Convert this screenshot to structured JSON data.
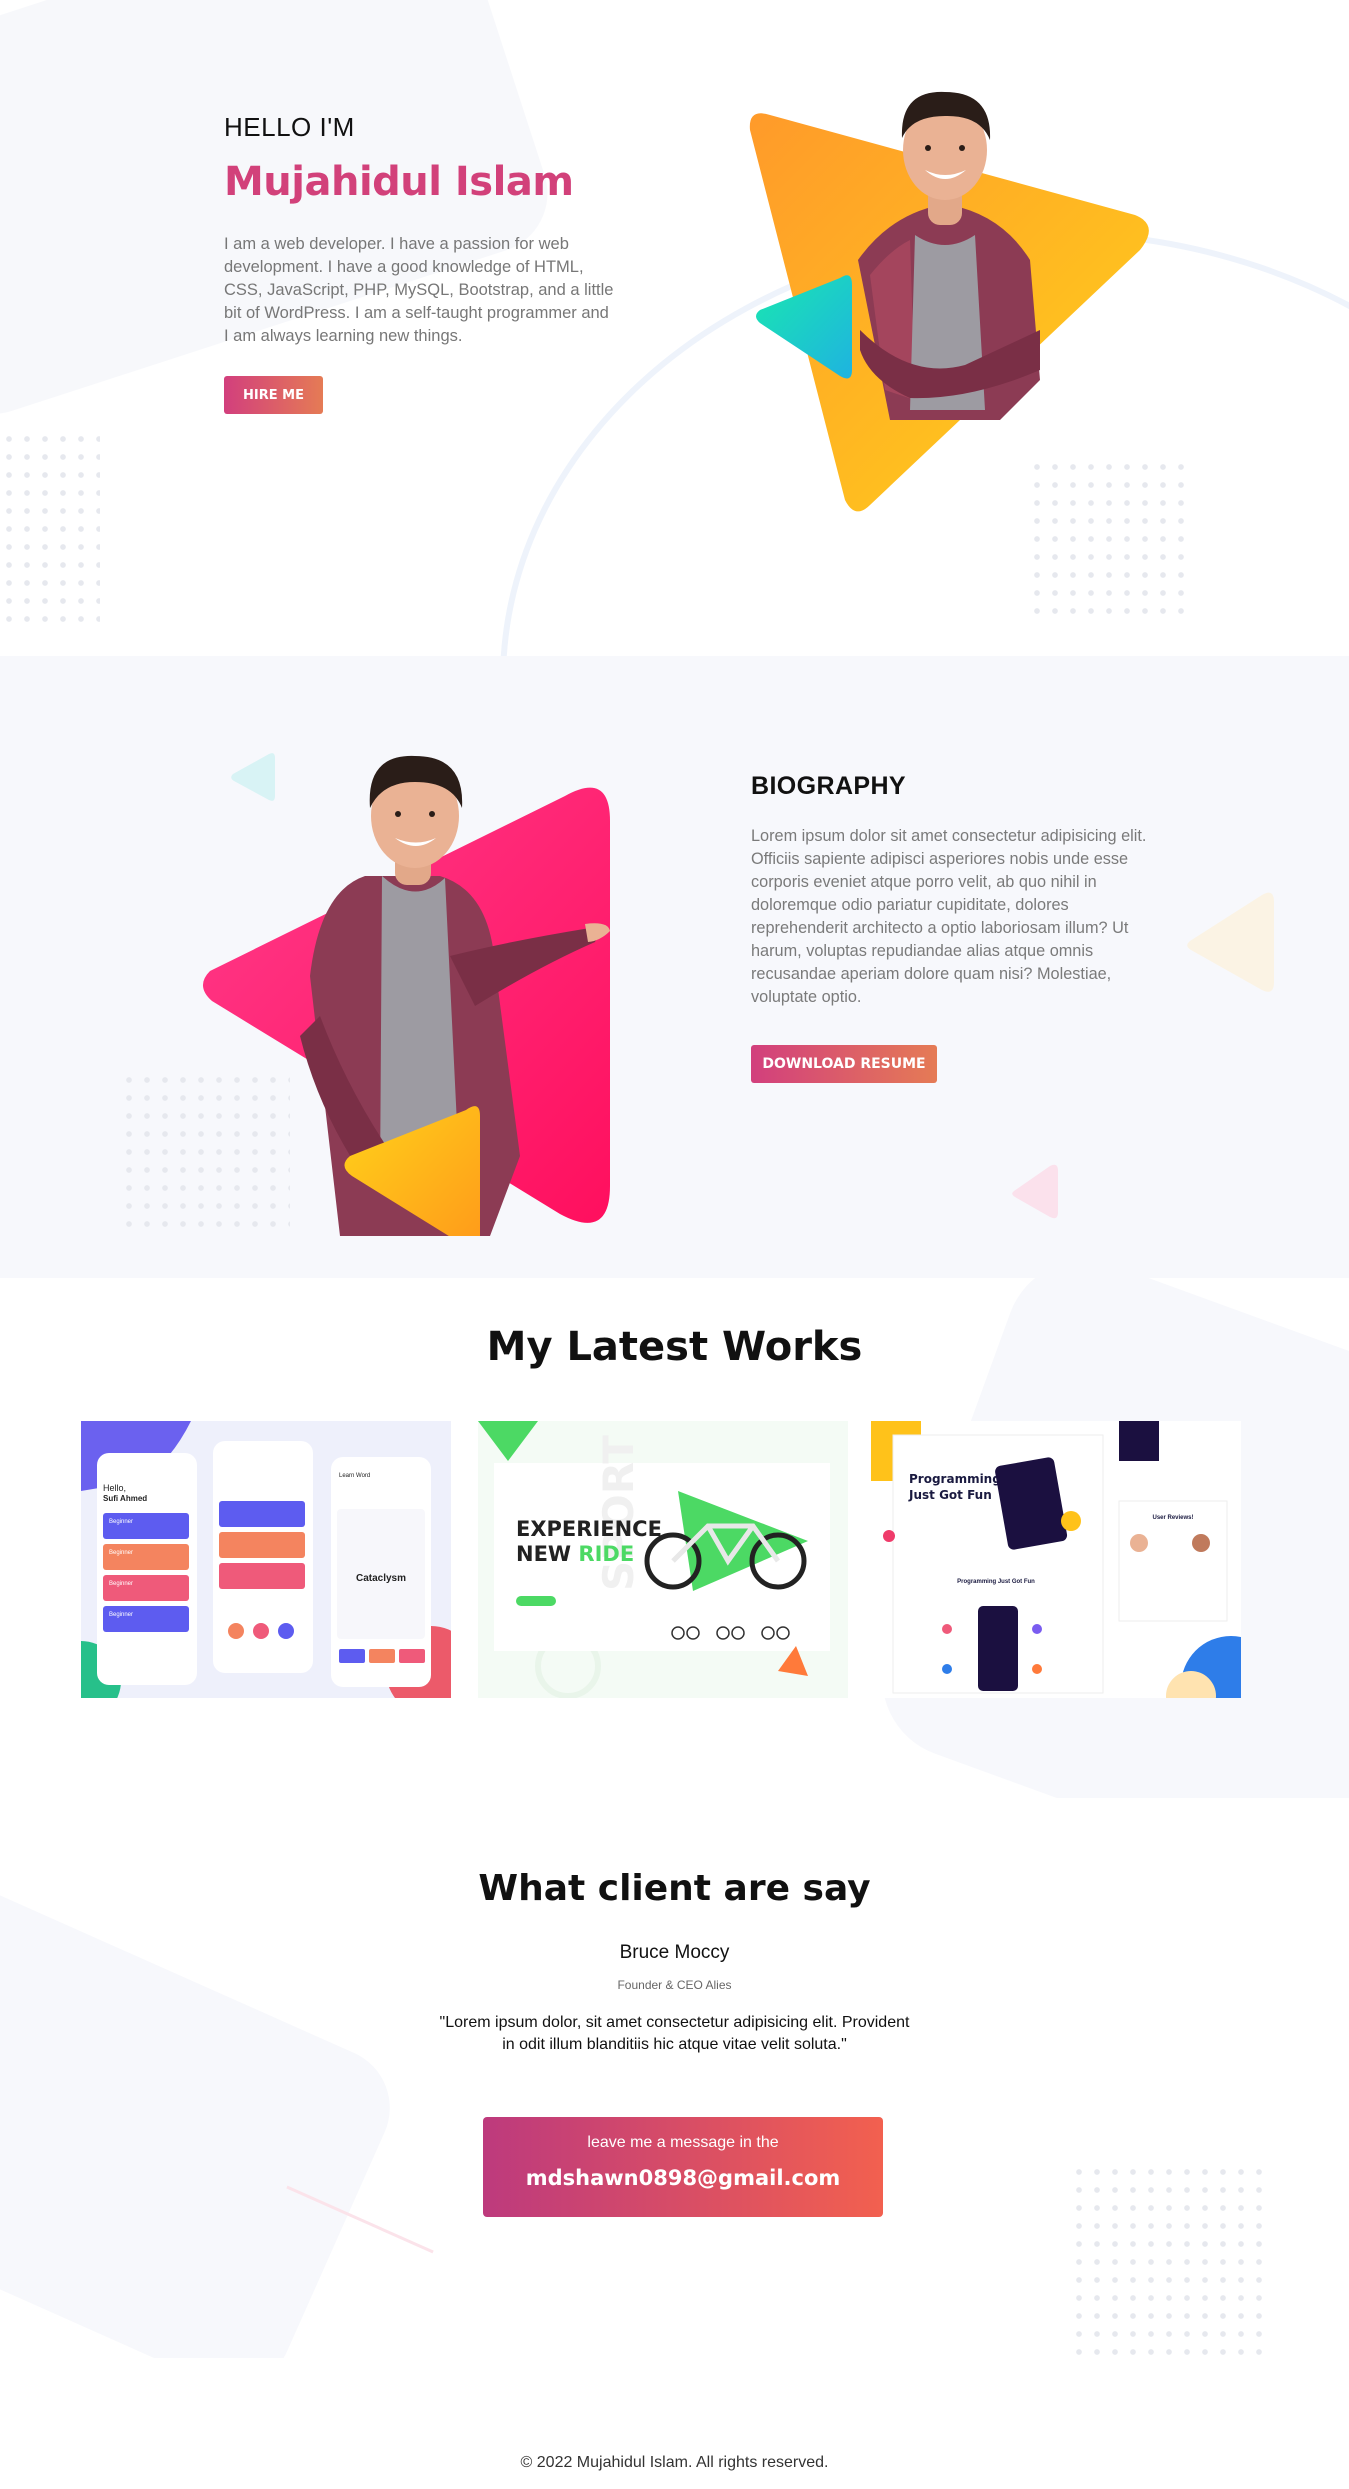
{
  "hero": {
    "greeting": "HELLO I'M",
    "name": "Mujahidul Islam",
    "description": "I am a web developer. I have a passion for web development. I have a good knowledge of HTML, CSS, JavaScript, PHP, MySQL, Bootstrap, and a little bit of WordPress. I am a self-taught programmer and I am always learning new things.",
    "cta_label": "HIRE ME",
    "image_icon": "person-portrait-icon"
  },
  "biography": {
    "title": "BIOGRAPHY",
    "text": "Lorem ipsum dolor sit amet consectetur adipisicing elit. Officiis sapiente adipisci asperiores nobis unde esse corporis eveniet atque porro velit, ab quo nihil in doloremque odio pariatur cupiditate, dolores reprehenderit architecto a optio laboriosam illum? Ut harum, voluptas repudiandae alias atque omnis recusandae aperiam dolore quam nisi? Molestiae, voluptate optio.",
    "cta_label": "DOWNLOAD RESUME"
  },
  "works": {
    "title": "My Latest Works",
    "items": [
      {
        "theme": "learning-app",
        "hello": "Hello,",
        "user": "Sufi Ahmed",
        "levels": [
          "Beginner",
          "Beginner",
          "Beginner",
          "Beginner"
        ],
        "card_word": "Cataclysm",
        "header_word": "Learn Word"
      },
      {
        "theme": "bike-shop",
        "headline_1": "EXPERIENCE",
        "headline_2a": "NEW ",
        "headline_2b": "RIDE",
        "watermark": "SPORT"
      },
      {
        "theme": "programming-site",
        "headline_1": "Programming",
        "headline_2": "Just Got Fun",
        "section": "Programming Just Got Fun",
        "reviews": "User Reviews!"
      }
    ]
  },
  "testimonial": {
    "title": "What client are say",
    "name": "Bruce Moccy",
    "role": "Founder & CEO Alies",
    "quote": "\"Lorem ipsum dolor, sit amet consectetur adipisicing elit. Provident in odit illum blanditiis hic atque vitae velit soluta.\""
  },
  "contact": {
    "lead": "leave me a message in the",
    "email": "mdshawn0898@gmail.com"
  },
  "footer": {
    "copyright": "© 2022 Mujahidul Islam. All rights reserved."
  },
  "colors": {
    "accent_pink": "#d2417a",
    "accent_orange": "#e57b55",
    "triangle_yellow": "#ffc21a",
    "triangle_orange": "#ff9a2a",
    "triangle_teal": "#16e0b5",
    "triangle_magenta": "#ff2d7a"
  }
}
